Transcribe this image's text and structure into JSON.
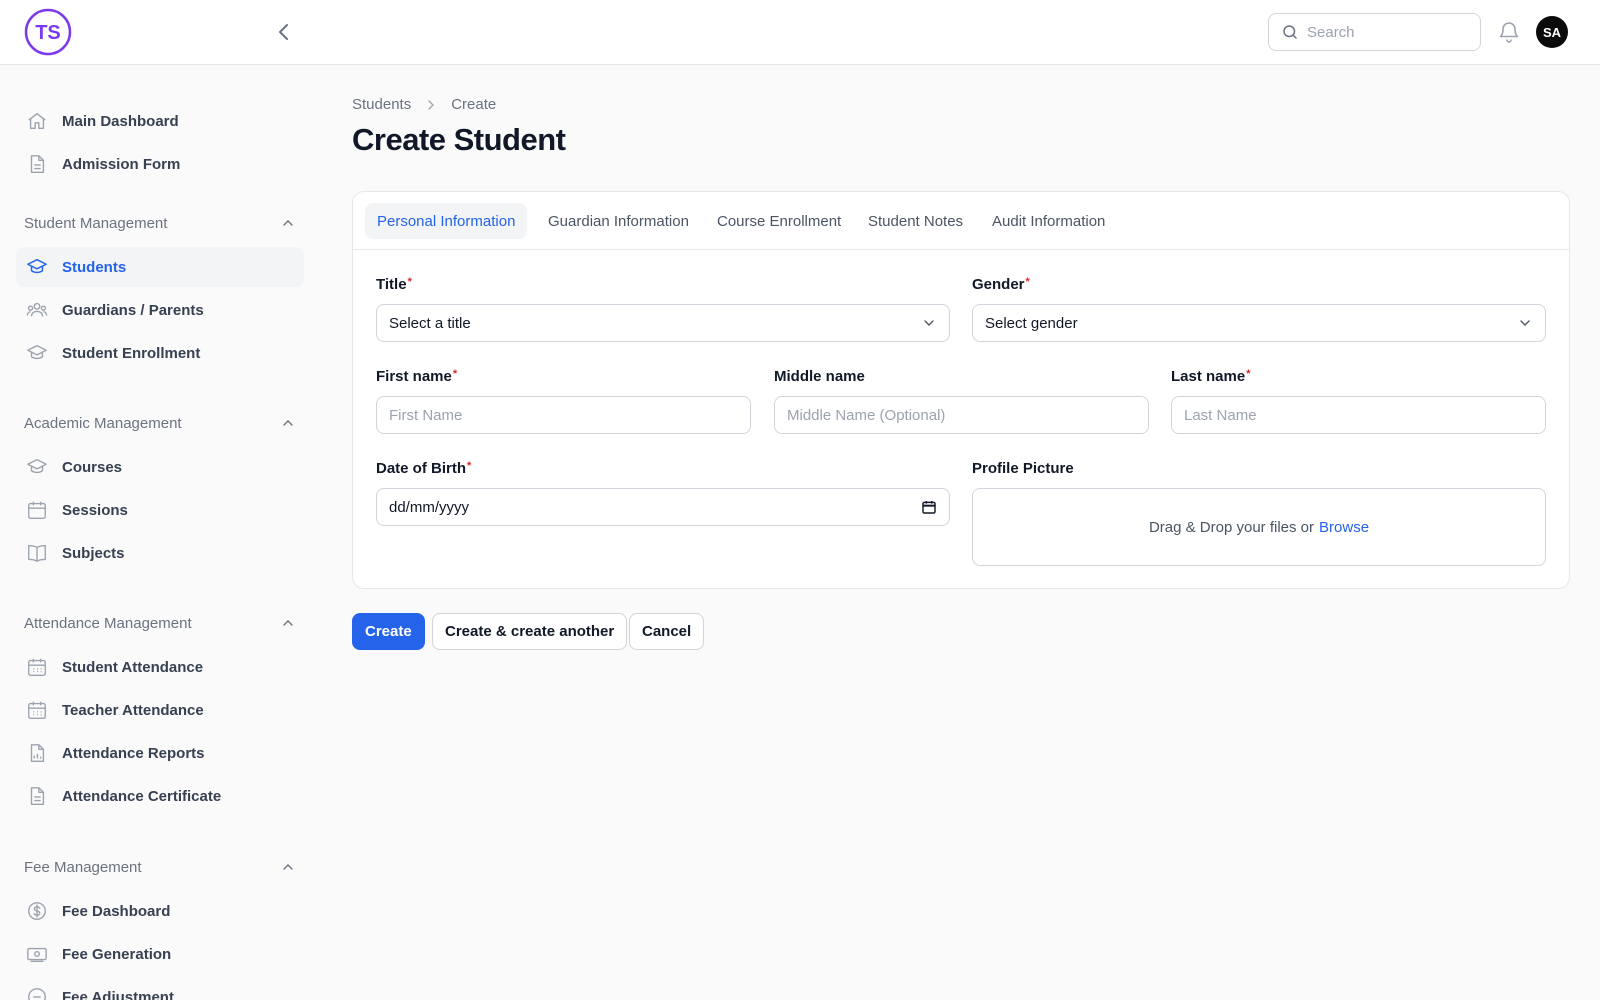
{
  "header": {
    "logo_text": "TS",
    "search_placeholder": "Search",
    "avatar_initials": "SA"
  },
  "sidebar": {
    "top_items": [
      {
        "label": "Main Dashboard",
        "icon": "home-icon"
      },
      {
        "label": "Admission Form",
        "icon": "document-icon"
      }
    ],
    "groups": [
      {
        "label": "Student Management",
        "items": [
          {
            "label": "Students",
            "icon": "graduation-cap-icon",
            "active": true
          },
          {
            "label": "Guardians / Parents",
            "icon": "users-icon"
          },
          {
            "label": "Student Enrollment",
            "icon": "graduation-cap-icon"
          }
        ]
      },
      {
        "label": "Academic Management",
        "items": [
          {
            "label": "Courses",
            "icon": "graduation-cap-icon"
          },
          {
            "label": "Sessions",
            "icon": "calendar-icon"
          },
          {
            "label": "Subjects",
            "icon": "book-icon"
          }
        ]
      },
      {
        "label": "Attendance Management",
        "items": [
          {
            "label": "Student Attendance",
            "icon": "calendar-days-icon"
          },
          {
            "label": "Teacher Attendance",
            "icon": "calendar-days-icon"
          },
          {
            "label": "Attendance Reports",
            "icon": "chart-document-icon"
          },
          {
            "label": "Attendance Certificate",
            "icon": "document-icon"
          }
        ]
      },
      {
        "label": "Fee Management",
        "items": [
          {
            "label": "Fee Dashboard",
            "icon": "dollar-circle-icon"
          },
          {
            "label": "Fee Generation",
            "icon": "banknote-icon"
          },
          {
            "label": "Fee Adjustment",
            "icon": "adjust-icon"
          }
        ]
      }
    ]
  },
  "breadcrumb": {
    "parent": "Students",
    "current": "Create"
  },
  "page_title": "Create Student",
  "tabs": [
    {
      "label": "Personal Information",
      "active": true
    },
    {
      "label": "Guardian Information"
    },
    {
      "label": "Course Enrollment"
    },
    {
      "label": "Student Notes"
    },
    {
      "label": "Audit Information"
    }
  ],
  "form": {
    "title": {
      "label": "Title",
      "required_mark": "*",
      "value": "Select a title"
    },
    "gender": {
      "label": "Gender",
      "required_mark": "*",
      "value": "Select gender"
    },
    "first_name": {
      "label": "First name",
      "required_mark": "*",
      "placeholder": "First Name"
    },
    "middle_name": {
      "label": "Middle name",
      "placeholder": "Middle Name (Optional)"
    },
    "last_name": {
      "label": "Last name",
      "required_mark": "*",
      "placeholder": "Last Name"
    },
    "dob": {
      "label": "Date of Birth",
      "required_mark": "*",
      "value": "dd/mm/yyyy"
    },
    "profile_picture": {
      "label": "Profile Picture",
      "drop_text": "Drag & Drop your files or",
      "browse_text": "Browse"
    }
  },
  "actions": {
    "create": "Create",
    "create_another": "Create & create another",
    "cancel": "Cancel"
  },
  "colors": {
    "primary": "#2563eb",
    "brand_purple": "#7c3aed",
    "required": "#dc2626"
  }
}
